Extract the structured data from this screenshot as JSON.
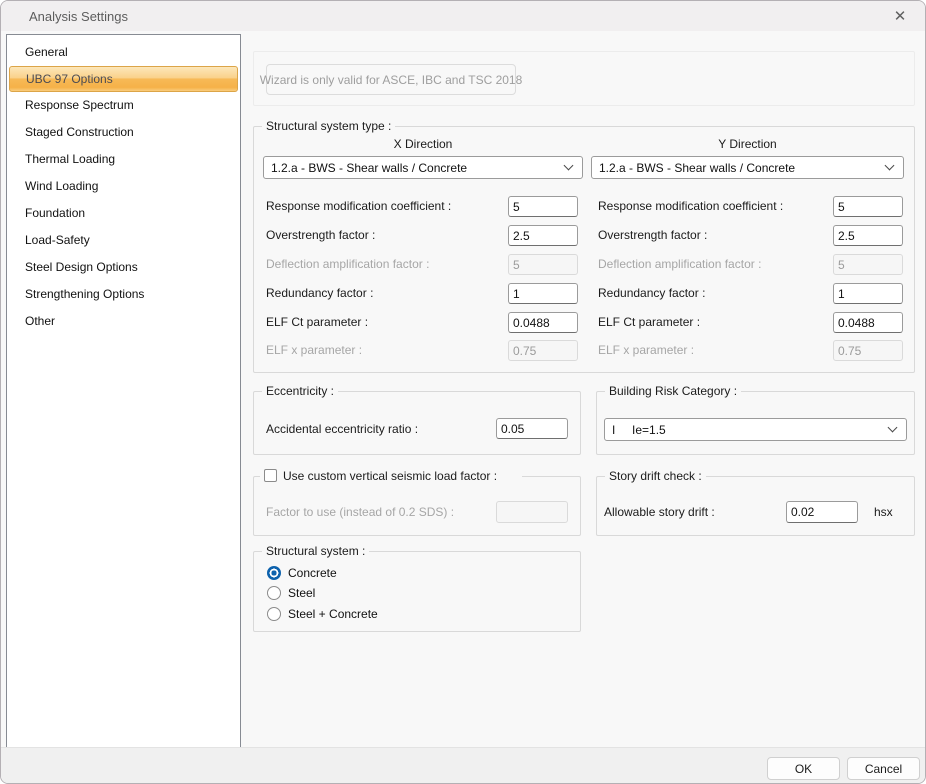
{
  "window": {
    "title": "Analysis Settings",
    "close_icon": "✕"
  },
  "sidebar": {
    "items": [
      {
        "label": "General",
        "selected": false
      },
      {
        "label": "UBC 97 Options",
        "selected": true
      },
      {
        "label": "Response Spectrum",
        "selected": false
      },
      {
        "label": "Staged Construction",
        "selected": false
      },
      {
        "label": "Thermal Loading",
        "selected": false
      },
      {
        "label": "Wind Loading",
        "selected": false
      },
      {
        "label": "Foundation",
        "selected": false
      },
      {
        "label": "Load-Safety",
        "selected": false
      },
      {
        "label": "Steel Design Options",
        "selected": false
      },
      {
        "label": "Strengthening Options",
        "selected": false
      },
      {
        "label": "Other",
        "selected": false
      }
    ]
  },
  "main": {
    "wizard_note": "Wizard is only valid for ASCE, IBC and TSC 2018",
    "structural_system_type": {
      "title": "Structural system type :",
      "columns": [
        {
          "header": "X Direction",
          "dropdown_value": "1.2.a - BWS - Shear walls / Concrete",
          "fields": [
            {
              "label": "Response modification coefficient :",
              "value": "5",
              "disabled": false
            },
            {
              "label": "Overstrength factor :",
              "value": "2.5",
              "disabled": false
            },
            {
              "label": "Deflection amplification factor :",
              "value": "5",
              "disabled": true
            },
            {
              "label": "Redundancy factor :",
              "value": "1",
              "disabled": false
            },
            {
              "label": "ELF Ct parameter :",
              "value": "0.0488",
              "disabled": false
            },
            {
              "label": "ELF x parameter :",
              "value": "0.75",
              "disabled": true
            }
          ]
        },
        {
          "header": "Y Direction",
          "dropdown_value": "1.2.a - BWS - Shear walls / Concrete",
          "fields": [
            {
              "label": "Response modification coefficient :",
              "value": "5",
              "disabled": false
            },
            {
              "label": "Overstrength factor :",
              "value": "2.5",
              "disabled": false
            },
            {
              "label": "Deflection amplification factor :",
              "value": "5",
              "disabled": true
            },
            {
              "label": "Redundancy factor :",
              "value": "1",
              "disabled": false
            },
            {
              "label": "ELF Ct parameter :",
              "value": "0.0488",
              "disabled": false
            },
            {
              "label": "ELF x parameter :",
              "value": "0.75",
              "disabled": true
            }
          ]
        }
      ]
    },
    "eccentricity": {
      "title": "Eccentricity :",
      "label": "Accidental eccentricity ratio :",
      "value": "0.05"
    },
    "building_risk_category": {
      "title": "Building Risk Category :",
      "dropdown_value": "I     Ie=1.5"
    },
    "custom_vertical_seismic": {
      "title": "Use custom vertical seismic load factor :",
      "checked": false,
      "factor_label": "Factor to use (instead of 0.2 SDS) :",
      "factor_value": ""
    },
    "story_drift_check": {
      "title": "Story drift check :",
      "label": "Allowable story drift :",
      "value": "0.02",
      "unit": "hsx"
    },
    "structural_system": {
      "title": "Structural system :",
      "options": [
        {
          "label": "Concrete",
          "selected": true
        },
        {
          "label": "Steel",
          "selected": false
        },
        {
          "label": "Steel + Concrete",
          "selected": false
        }
      ]
    }
  },
  "footer": {
    "ok_label": "OK",
    "cancel_label": "Cancel"
  },
  "colors": {
    "sidebar_selected_top": "#fce7ba",
    "sidebar_selected_bottom": "#f6b148",
    "sidebar_selected_border": "#dca548",
    "radio_accent": "#0d62ad",
    "disabled_text": "#a6a6a6",
    "titlebar_bg": "#f1eff0"
  }
}
